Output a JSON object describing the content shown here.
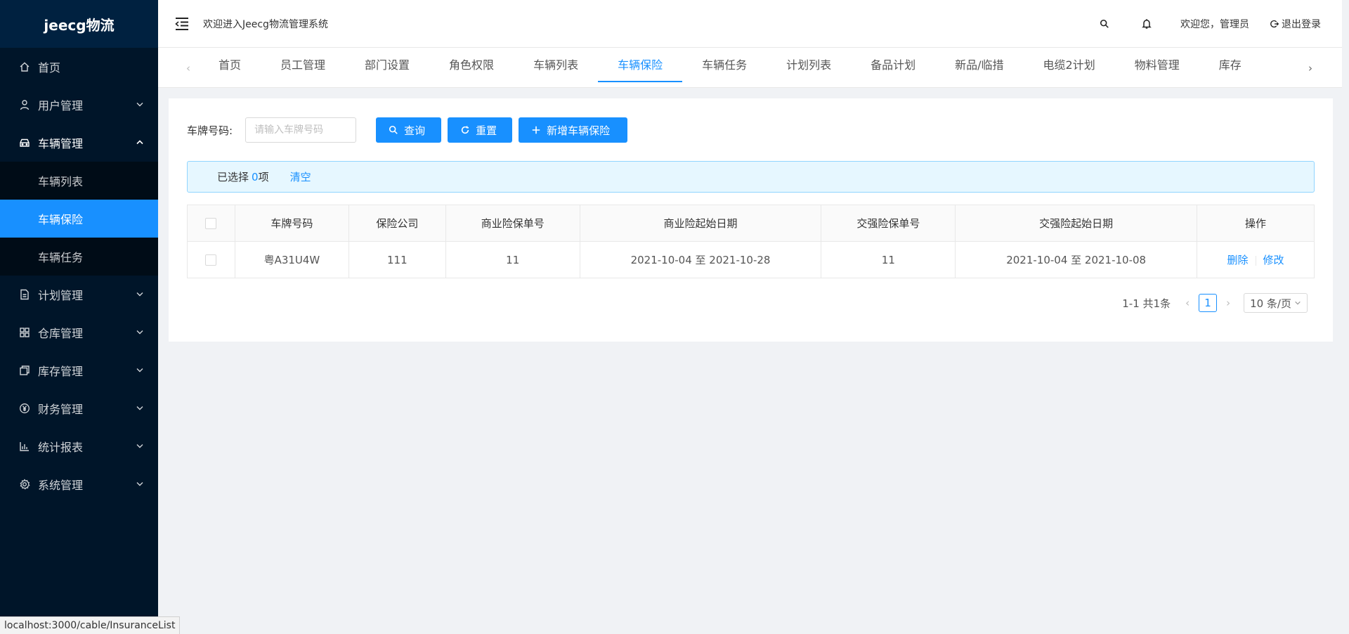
{
  "sidebar": {
    "logo": "jeecg物流",
    "items": [
      {
        "label": "首页",
        "icon": "home-icon"
      },
      {
        "label": "用户管理",
        "icon": "user-icon"
      },
      {
        "label": "车辆管理",
        "icon": "car-icon"
      },
      {
        "label": "计划管理",
        "icon": "file-icon"
      },
      {
        "label": "仓库管理",
        "icon": "grid-icon"
      },
      {
        "label": "库存管理",
        "icon": "copy-icon"
      },
      {
        "label": "财务管理",
        "icon": "yen-icon"
      },
      {
        "label": "统计报表",
        "icon": "bar-chart-icon"
      },
      {
        "label": "系统管理",
        "icon": "settings-icon"
      }
    ],
    "submenu": [
      "车辆列表",
      "车辆保险",
      "车辆任务"
    ]
  },
  "header": {
    "title": "欢迎进入Jeecg物流管理系统",
    "welcome": "欢迎您，管理员",
    "logout": "退出登录"
  },
  "tabs": [
    "首页",
    "员工管理",
    "部门设置",
    "角色权限",
    "车辆列表",
    "车辆保险",
    "车辆任务",
    "计划列表",
    "备品计划",
    "新品/临措",
    "电缆2计划",
    "物料管理",
    "库存"
  ],
  "search": {
    "label": "车牌号码:",
    "placeholder": "请输入车牌号码",
    "value": ""
  },
  "buttons": {
    "query": "查询",
    "reset": "重置",
    "add": "新增车辆保险"
  },
  "selection": {
    "prefix": "已选择",
    "count": "0",
    "suffix": "项",
    "clear": "清空"
  },
  "table": {
    "columns": [
      "车牌号码",
      "保险公司",
      "商业险保单号",
      "商业险起始日期",
      "交强险保单号",
      "交强险起始日期",
      "操作"
    ],
    "rows": [
      {
        "plate": "粤A31U4W",
        "company": "111",
        "commercial_no": "11",
        "commercial_dates": "2021-10-04 至 2021-10-28",
        "compulsory_no": "11",
        "compulsory_dates": "2021-10-04 至 2021-10-08",
        "delete": "删除",
        "edit": "修改"
      }
    ]
  },
  "pagination": {
    "total": "1-1 共1条",
    "current": "1",
    "page_size": "10 条/页"
  },
  "status_bar": "localhost:3000/cable/InsuranceList",
  "colors": {
    "primary": "#1890ff",
    "sidebar_bg": "#001529",
    "submenu_bg": "#000c17"
  }
}
